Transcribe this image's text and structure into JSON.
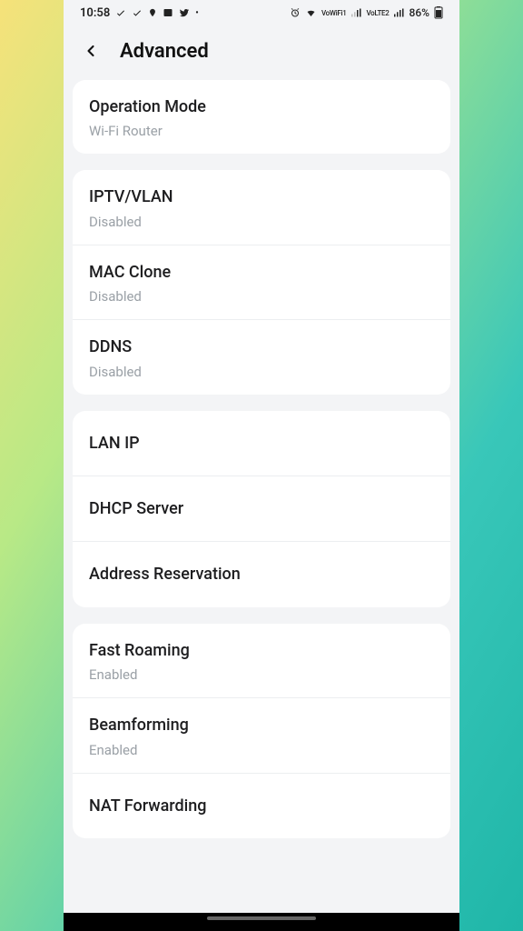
{
  "statusbar": {
    "time": "10:58",
    "battery": "86%",
    "net1": "VoWiFi1",
    "net2": "VoLTE2"
  },
  "header": {
    "title": "Advanced"
  },
  "group1": {
    "operation_mode": {
      "title": "Operation Mode",
      "sub": "Wi-Fi Router"
    }
  },
  "group2": {
    "iptv": {
      "title": "IPTV/VLAN",
      "sub": "Disabled"
    },
    "mac_clone": {
      "title": "MAC Clone",
      "sub": "Disabled"
    },
    "ddns": {
      "title": "DDNS",
      "sub": "Disabled"
    }
  },
  "group3": {
    "lan_ip": {
      "title": "LAN IP"
    },
    "dhcp": {
      "title": "DHCP Server"
    },
    "addr_res": {
      "title": "Address Reservation"
    }
  },
  "group4": {
    "fast_roaming": {
      "title": "Fast Roaming",
      "sub": "Enabled"
    },
    "beamforming": {
      "title": "Beamforming",
      "sub": "Enabled"
    },
    "nat_fwd": {
      "title": "NAT Forwarding"
    }
  }
}
